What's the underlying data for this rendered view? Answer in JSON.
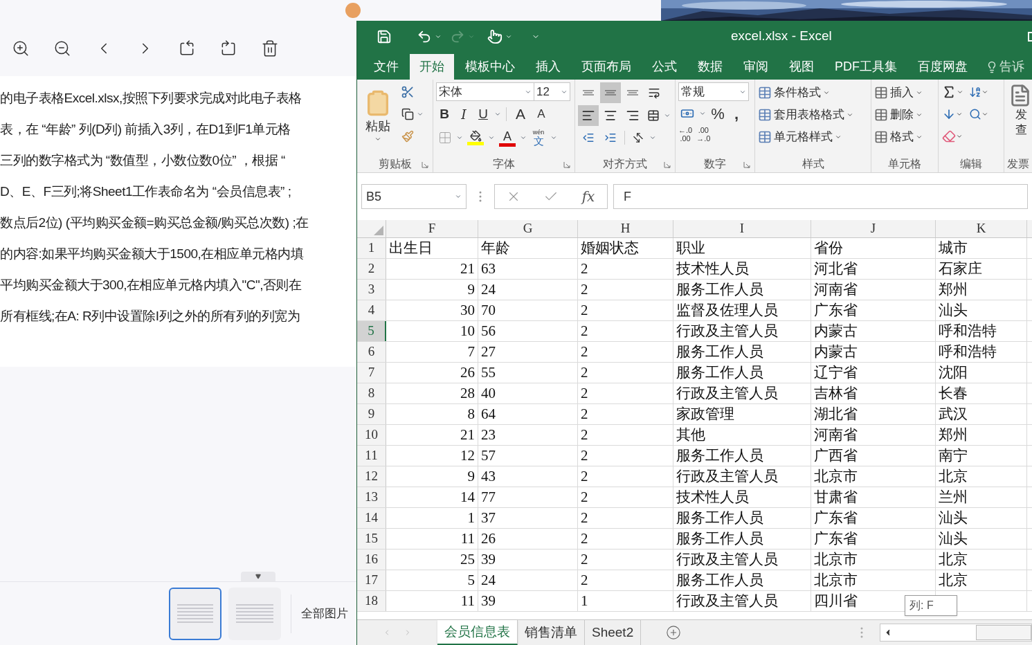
{
  "pdf_viewer": {
    "text_lines": [
      "的电子表格Excel.xlsx,按照下列要求完成对此电子表格",
      "表，在 “年龄” 列(D列) 前插入3列，在D1到F1单元格",
      "三列的数字格式为 “数值型，小数位数0位” ，根据 “",
      "D、E、F三列;将Sheet1工作表命名为 “会员信息表” ;",
      "数点后2位) (平均购买金额=购买总金额/购买总次数) ;在",
      "的内容:如果平均购买金额大于1500,在相应单元格内填",
      "平均购买金额大于300,在相应单元格内填入\"C\",否则在",
      "所有框线;在A: R列中设置除I列之外的所有列的列宽为"
    ],
    "thumbnails": [
      {
        "selected": true
      },
      {
        "selected": false
      }
    ],
    "all_images": "全部图片"
  },
  "excel": {
    "title": "excel.xlsx - Excel",
    "tabs": [
      {
        "label": "文件",
        "selected": false
      },
      {
        "label": "开始",
        "selected": true
      },
      {
        "label": "模板中心",
        "selected": false
      },
      {
        "label": "插入",
        "selected": false
      },
      {
        "label": "页面布局",
        "selected": false
      },
      {
        "label": "公式",
        "selected": false
      },
      {
        "label": "数据",
        "selected": false
      },
      {
        "label": "审阅",
        "selected": false
      },
      {
        "label": "视图",
        "selected": false
      },
      {
        "label": "PDF工具集",
        "selected": false
      },
      {
        "label": "百度网盘",
        "selected": false
      }
    ],
    "tell_me": "告诉",
    "ribbon": {
      "paste": "粘贴",
      "font_name": "宋体",
      "font_size": "12",
      "bold": "B",
      "italic": "I",
      "underline": "U",
      "grow": "A",
      "shrink": "A",
      "font_color": "A",
      "phonetic_top": "wén",
      "phonetic": "文",
      "vertical_align": [
        {
          "selected": false
        },
        {
          "selected": true
        },
        {
          "selected": false
        }
      ],
      "horizontal_align": [
        {
          "selected": true
        },
        {
          "selected": false
        },
        {
          "selected": false
        }
      ],
      "number_format": "常规",
      "percent": "%",
      "comma": ",",
      "decimal_increase": [
        "←.0",
        ".00"
      ],
      "decimal_decrease": [
        ".00",
        "→.0"
      ],
      "styles": [
        "条件格式",
        "套用表格格式",
        "单元格样式"
      ],
      "cells": [
        "插入",
        "删除",
        "格式"
      ],
      "invoice": [
        "发",
        "查"
      ],
      "groups": [
        "剪贴板",
        "字体",
        "对齐方式",
        "数字",
        "样式",
        "单元格",
        "编辑",
        "发票"
      ]
    },
    "name_box": "B5",
    "fx": "fx",
    "formula": "F",
    "columns": [
      {
        "label": "F",
        "numeric": true
      },
      {
        "label": "G",
        "numeric": false
      },
      {
        "label": "H",
        "numeric": false
      },
      {
        "label": "I",
        "numeric": false
      },
      {
        "label": "J",
        "numeric": false
      },
      {
        "label": "K",
        "numeric": false
      }
    ],
    "rows": [
      {
        "number": "1",
        "kind": "header",
        "selected": false,
        "cells": [
          "出生日",
          "年龄",
          "婚姻状态",
          "职业",
          "省份",
          "城市"
        ]
      },
      {
        "number": "2",
        "kind": "data",
        "selected": false,
        "cells": [
          "21",
          "63",
          "2",
          "技术性人员",
          "河北省",
          "石家庄"
        ]
      },
      {
        "number": "3",
        "kind": "data",
        "selected": false,
        "cells": [
          "9",
          "24",
          "2",
          "服务工作人员",
          "河南省",
          "郑州"
        ]
      },
      {
        "number": "4",
        "kind": "data",
        "selected": false,
        "cells": [
          "30",
          "70",
          "2",
          "监督及佐理人员",
          "广东省",
          "汕头"
        ]
      },
      {
        "number": "5",
        "kind": "data",
        "selected": true,
        "cells": [
          "10",
          "56",
          "2",
          "行政及主管人员",
          "内蒙古",
          "呼和浩特"
        ]
      },
      {
        "number": "6",
        "kind": "data",
        "selected": false,
        "cells": [
          "7",
          "27",
          "2",
          "服务工作人员",
          "内蒙古",
          "呼和浩特"
        ]
      },
      {
        "number": "7",
        "kind": "data",
        "selected": false,
        "cells": [
          "26",
          "55",
          "2",
          "服务工作人员",
          "辽宁省",
          "沈阳"
        ]
      },
      {
        "number": "8",
        "kind": "data",
        "selected": false,
        "cells": [
          "28",
          "40",
          "2",
          "行政及主管人员",
          "吉林省",
          "长春"
        ]
      },
      {
        "number": "9",
        "kind": "data",
        "selected": false,
        "cells": [
          "8",
          "64",
          "2",
          "家政管理",
          "湖北省",
          "武汉"
        ]
      },
      {
        "number": "10",
        "kind": "data",
        "selected": false,
        "cells": [
          "21",
          "23",
          "2",
          "其他",
          "河南省",
          "郑州"
        ]
      },
      {
        "number": "11",
        "kind": "data",
        "selected": false,
        "cells": [
          "12",
          "57",
          "2",
          "服务工作人员",
          "广西省",
          "南宁"
        ]
      },
      {
        "number": "12",
        "kind": "data",
        "selected": false,
        "cells": [
          "9",
          "43",
          "2",
          "行政及主管人员",
          "北京市",
          "北京"
        ]
      },
      {
        "number": "13",
        "kind": "data",
        "selected": false,
        "cells": [
          "14",
          "77",
          "2",
          "技术性人员",
          "甘肃省",
          "兰州"
        ]
      },
      {
        "number": "14",
        "kind": "data",
        "selected": false,
        "cells": [
          "1",
          "37",
          "2",
          "服务工作人员",
          "广东省",
          "汕头"
        ]
      },
      {
        "number": "15",
        "kind": "data",
        "selected": false,
        "cells": [
          "11",
          "26",
          "2",
          "服务工作人员",
          "广东省",
          "汕头"
        ]
      },
      {
        "number": "16",
        "kind": "data",
        "selected": false,
        "cells": [
          "25",
          "39",
          "2",
          "行政及主管人员",
          "北京市",
          "北京"
        ]
      },
      {
        "number": "17",
        "kind": "data",
        "selected": false,
        "cells": [
          "5",
          "24",
          "2",
          "服务工作人员",
          "北京市",
          "北京"
        ]
      },
      {
        "number": "18",
        "kind": "data",
        "selected": false,
        "cells": [
          "11",
          "39",
          "1",
          "行政及主管人员",
          "四川省"
        ]
      }
    ],
    "sheet_tabs": [
      {
        "label": "会员信息表",
        "selected": true
      },
      {
        "label": "销售清单",
        "selected": false
      },
      {
        "label": "Sheet2",
        "selected": false
      }
    ],
    "tooltip": "列: F"
  }
}
